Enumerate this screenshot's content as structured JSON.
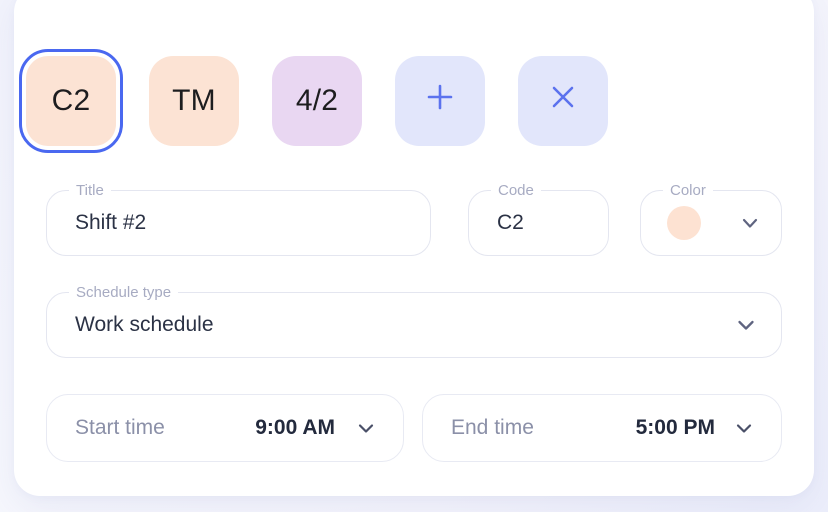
{
  "theme": {
    "page_background": "#f2f3fc",
    "card_background": "#ffffff",
    "accent_blue": "#4a68f0",
    "glyph_blue": "#5b72ee",
    "peach": "#fce3d4",
    "purple": "#e9d7f2",
    "lavender": "#e2e6fb",
    "label_grey": "#a7abc2",
    "text_dark": "#2b3245",
    "chevron_grey": "#5f6480"
  },
  "chips": [
    {
      "label": "C2",
      "icon": "",
      "background": "#fce3d4",
      "selected": true
    },
    {
      "label": "TM",
      "icon": "",
      "background": "#fce3d4",
      "selected": false
    },
    {
      "label": "4/2",
      "icon": "",
      "background": "#e9d7f2",
      "selected": false
    },
    {
      "label": "",
      "icon": "plus-icon",
      "background": "#e2e6fb",
      "selected": false
    },
    {
      "label": "",
      "icon": "close-icon",
      "background": "#e2e6fb",
      "selected": false
    }
  ],
  "fields": {
    "title": {
      "label": "Title",
      "value": "Shift #2",
      "placeholder": "Title"
    },
    "code": {
      "label": "Code",
      "value": "C2",
      "placeholder": "Code"
    },
    "color": {
      "label": "Color",
      "value": "",
      "swatch_color": "#fde2d2",
      "chevron": "chevron-down-icon"
    },
    "schedule_type": {
      "label": "Schedule type",
      "value": "Work schedule",
      "chevron": "chevron-down-icon",
      "options": [
        "Work schedule"
      ]
    }
  },
  "time": {
    "start": {
      "label": "Start time",
      "value": "9:00 AM",
      "chevron": "chevron-down-icon"
    },
    "end": {
      "label": "End time",
      "value": "5:00 PM",
      "chevron": "chevron-down-icon"
    }
  }
}
